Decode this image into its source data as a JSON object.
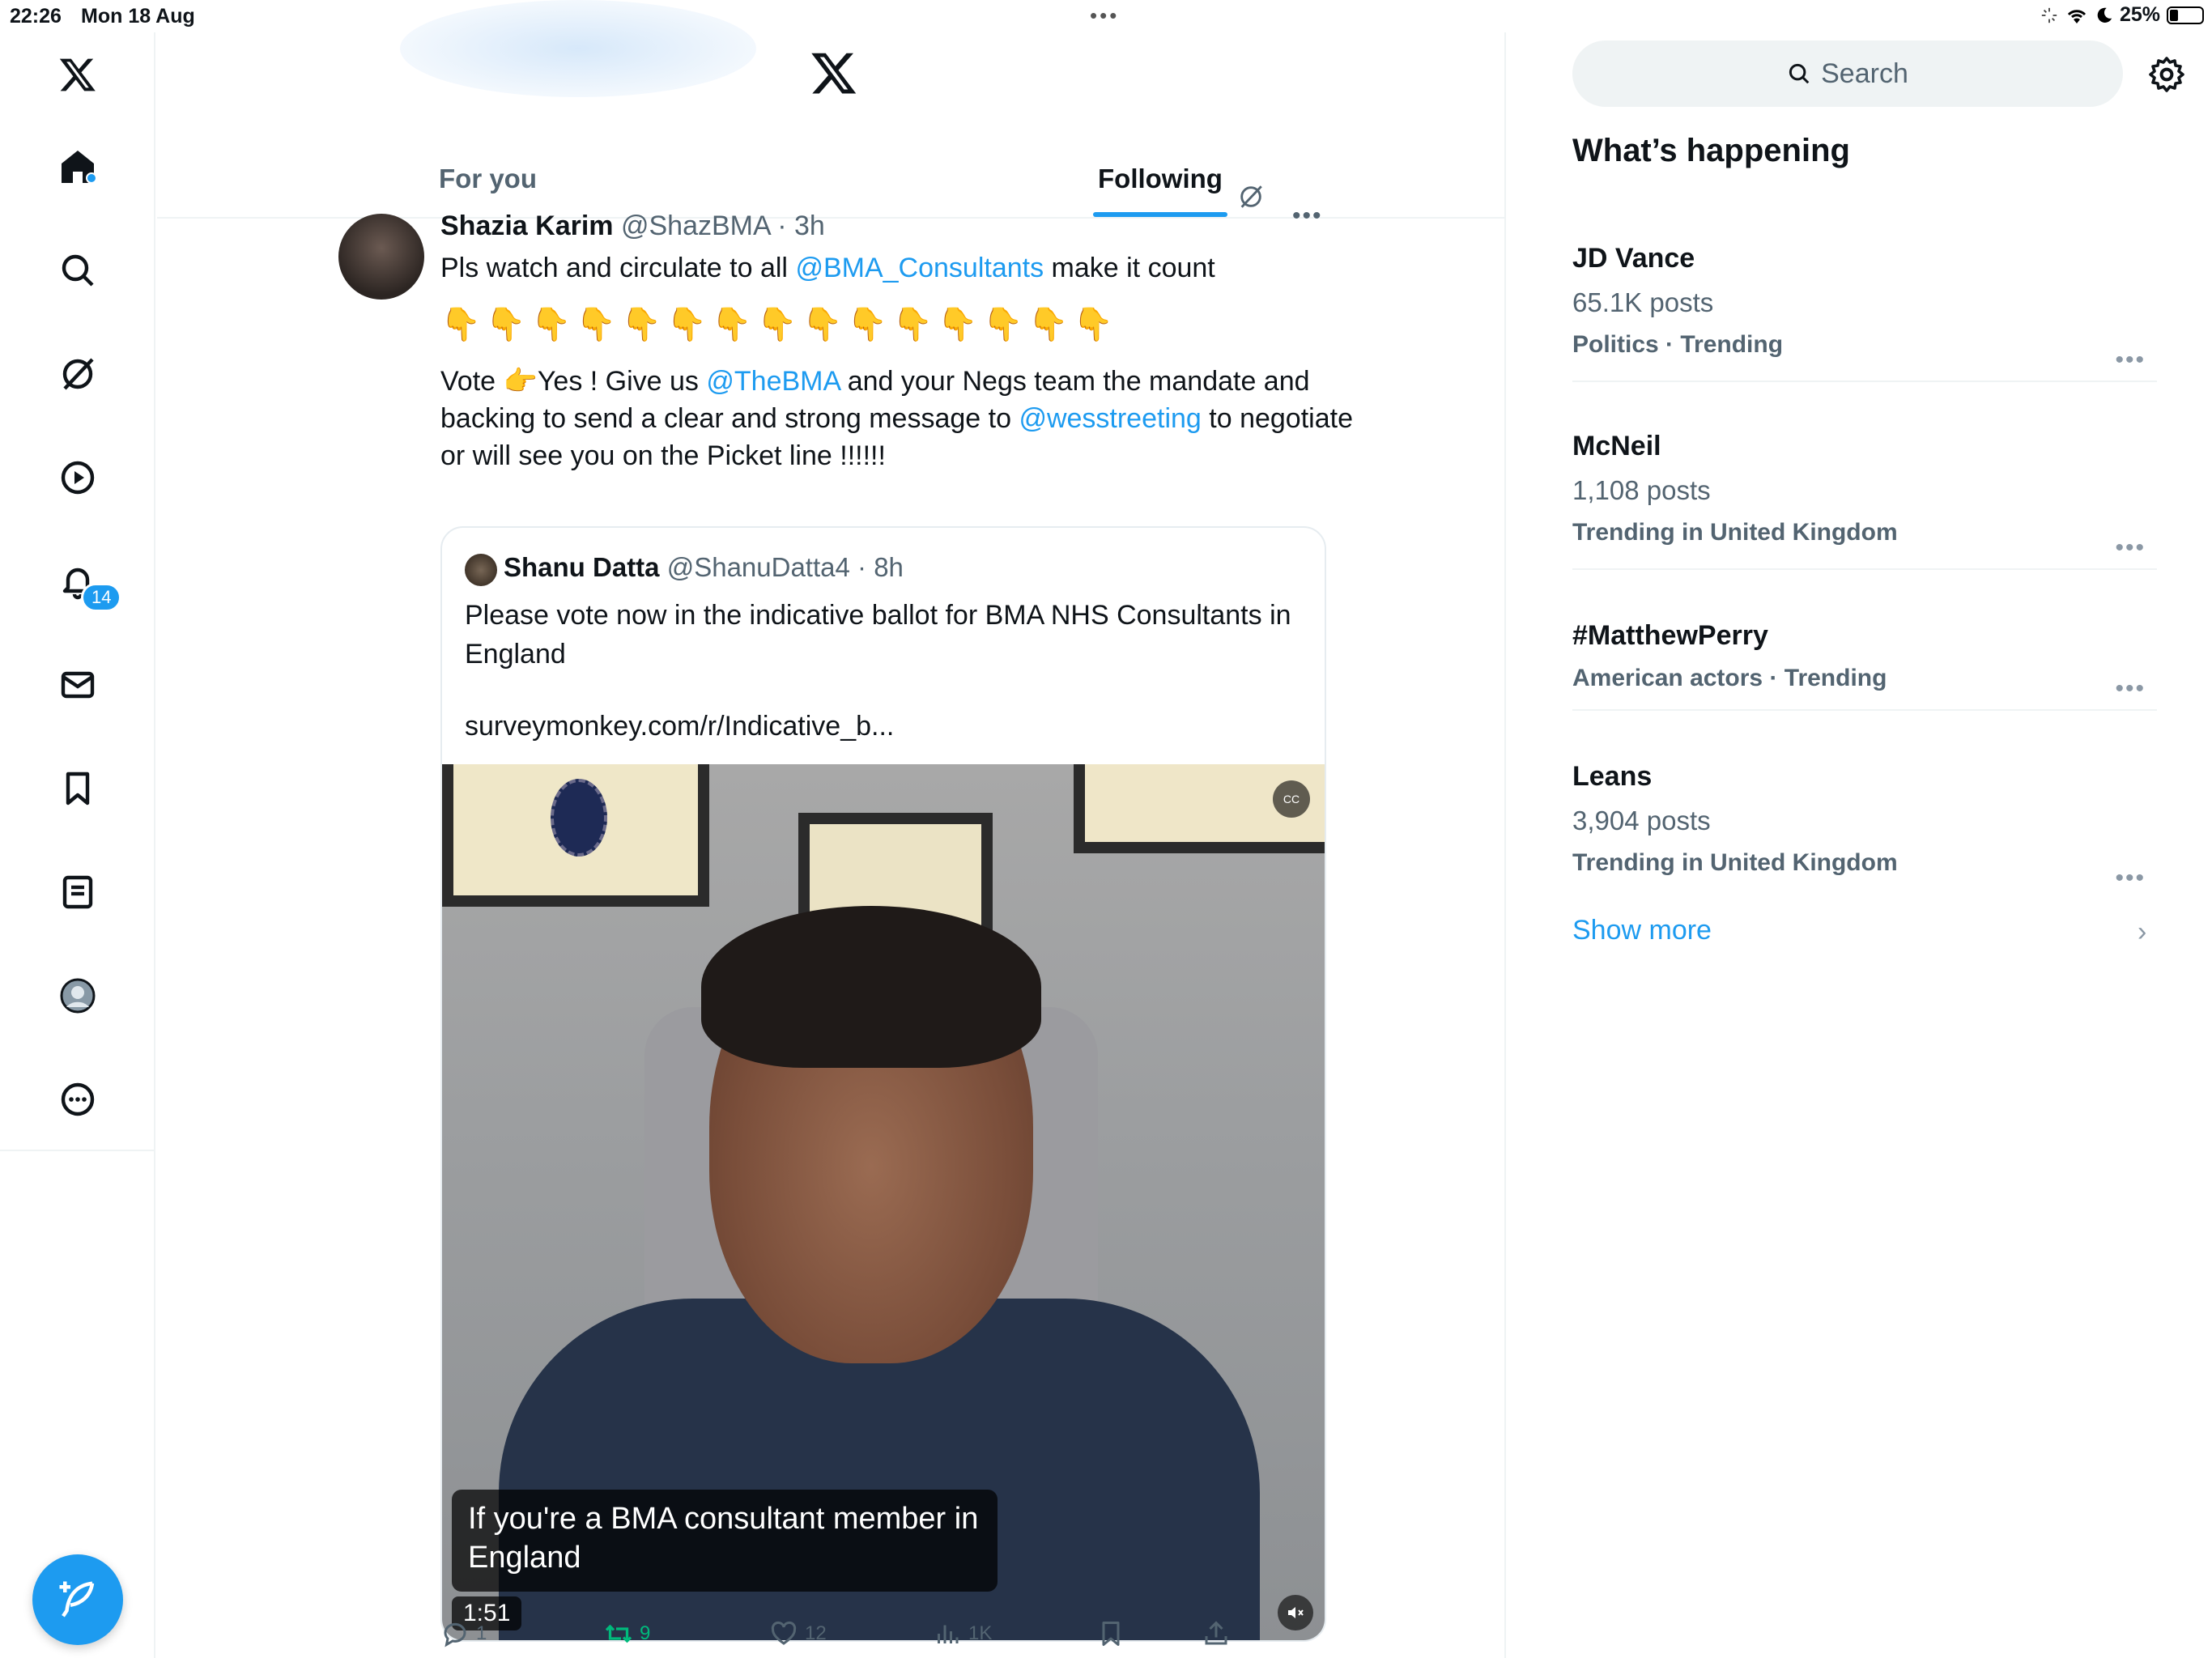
{
  "status_bar": {
    "time": "22:26",
    "date": "Mon 18 Aug",
    "battery": "25%"
  },
  "header": {
    "tabs": [
      {
        "label": "For you",
        "active": false
      },
      {
        "label": "Following",
        "active": true
      }
    ]
  },
  "sidebar": {
    "notifications_badge": "14"
  },
  "tweet": {
    "author_name": "Shazia Karim",
    "author_handle": "@ShazBMA",
    "time": "· 3h",
    "line1_text": "Pls watch and circulate to all ",
    "line1_mention": "@BMA_Consultants",
    "line1_tail": " make it count",
    "emoji_row": "👇👇👇👇👇👇👇👇👇👇👇👇👇👇👇",
    "p2_a": "Vote 👉Yes ! Give us ",
    "p2_mention1": "@TheBMA",
    "p2_b": " and your Negs team the mandate and backing to send a clear and strong message to ",
    "p2_mention2": "@wesstreeting",
    "p2_c": " to negotiate or will see you on the Picket line !!!!!!",
    "quote": {
      "author_name": "Shanu Datta",
      "author_handle": "@ShanuDatta4",
      "time": "· 8h",
      "text": "Please vote now in the indicative ballot for BMA NHS Consultants in England",
      "url": "surveymonkey.com/r/Indicative_b...",
      "video": {
        "caption": "If you're a BMA consultant member in England",
        "duration": "1:51",
        "cc_label": "CC"
      }
    },
    "actions": {
      "replies": "1",
      "retweets": "9",
      "likes": "12",
      "views": "1K"
    }
  },
  "right": {
    "search_placeholder": "Search",
    "whats_happening": "What’s happening",
    "trends": [
      {
        "name": "JD Vance",
        "posts": "65.1K posts",
        "category": "Politics · Trending"
      },
      {
        "name": "McNeil",
        "posts": "1,108 posts",
        "category": "Trending in United Kingdom"
      },
      {
        "name": "#MatthewPerry",
        "posts": "",
        "category": "American actors · Trending"
      },
      {
        "name": "Leans",
        "posts": "3,904 posts",
        "category": "Trending in United Kingdom"
      }
    ],
    "show_more": "Show more"
  },
  "colors": {
    "accent": "#1d9bf0",
    "retweet_active": "#00ba7c",
    "muted_text": "#536471"
  }
}
